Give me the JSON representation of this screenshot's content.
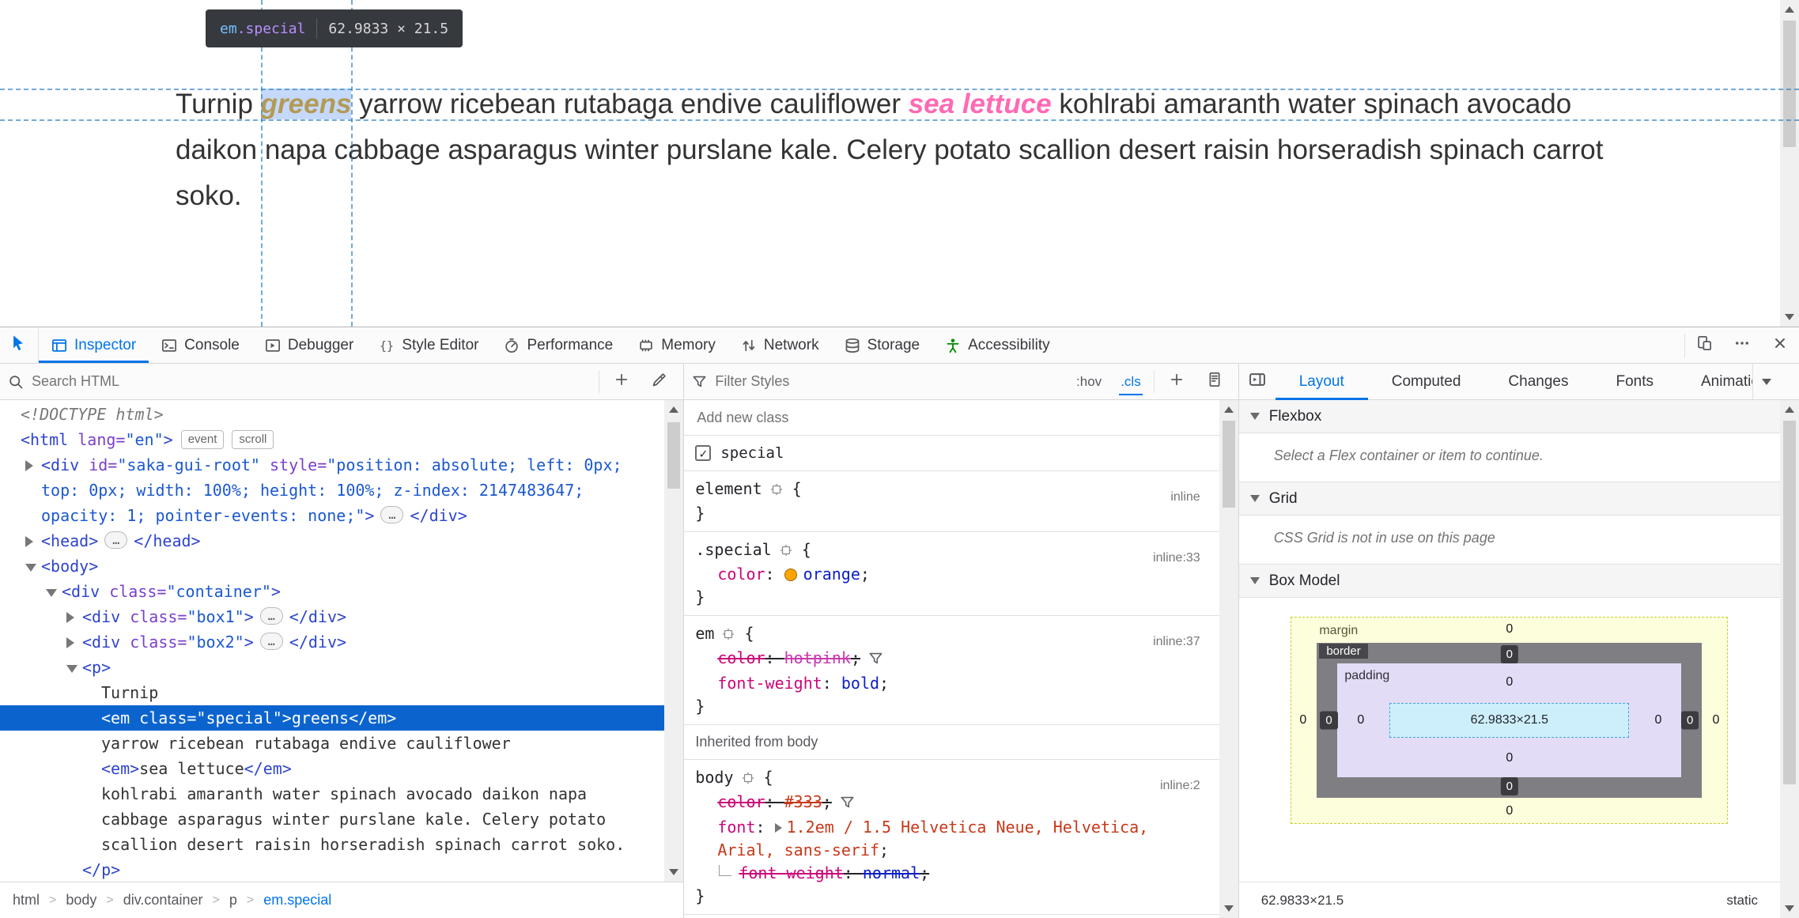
{
  "page": {
    "highlight_tooltip": {
      "tag": "em",
      "class": ".special",
      "dimensions": "62.9833 × 21.5"
    },
    "paragraph": {
      "t1": "Turnip ",
      "em_special": "greens",
      "t2": " yarrow ricebean rutabaga endive cauliflower ",
      "em": "sea lettuce",
      "t3": " kohlrabi amaranth water spinach avocado daikon napa cabbage asparagus winter purslane kale. Celery potato scallion desert raisin horseradish spinach carrot soko."
    },
    "colors": {
      "em_special_css": "orange",
      "em_css": "hotpink",
      "body_text": "#333",
      "highlight_fill": "#c4d9fb",
      "accent_blue": "#0074e8",
      "selection_blue": "#0b64ce"
    }
  },
  "toolbar": {
    "picker_icon": "picker-icon",
    "tabs": [
      {
        "label": "Inspector",
        "icon": "inspector-icon",
        "active": true
      },
      {
        "label": "Console",
        "icon": "console-icon"
      },
      {
        "label": "Debugger",
        "icon": "debugger-icon"
      },
      {
        "label": "Style Editor",
        "icon": "style-editor-icon"
      },
      {
        "label": "Performance",
        "icon": "performance-icon"
      },
      {
        "label": "Memory",
        "icon": "memory-icon"
      },
      {
        "label": "Network",
        "icon": "network-icon"
      },
      {
        "label": "Storage",
        "icon": "storage-icon"
      },
      {
        "label": "Accessibility",
        "icon": "accessibility-icon"
      }
    ],
    "right_buttons": [
      {
        "icon": "responsive-design-icon"
      },
      {
        "icon": "meatball-menu-icon"
      },
      {
        "icon": "close-icon"
      }
    ]
  },
  "markup_panel": {
    "search_placeholder": "Search HTML",
    "action_icons": [
      "add-node-icon",
      "eyedropper-icon"
    ],
    "lines": [
      {
        "indent": 0,
        "parts": [
          {
            "c": "doctype",
            "t": "<!DOCTYPE html>"
          }
        ]
      },
      {
        "indent": 0,
        "parts": [
          {
            "c": "tag",
            "t": "<html"
          },
          {
            "c": "attr",
            "t": " lang="
          },
          {
            "c": "val",
            "t": "\"en\""
          },
          {
            "c": "tag",
            "t": ">"
          },
          {
            "c": "badge",
            "t": "event"
          },
          {
            "c": "badge",
            "t": "scroll"
          }
        ]
      },
      {
        "indent": 1,
        "tw": "closed",
        "parts": [
          {
            "c": "tag",
            "t": "<div"
          },
          {
            "c": "attr",
            "t": " id="
          },
          {
            "c": "val",
            "t": "\"saka-gui-root\""
          },
          {
            "c": "attr",
            "t": " style="
          },
          {
            "c": "val",
            "t": "\"position: absolute; left: 0px; top: 0px; width: 100%; height: 100%; z-index: 2147483647; opacity: 1; pointer-events: none;\""
          },
          {
            "c": "tag",
            "t": ">"
          },
          {
            "c": "ellipsis",
            "t": "…"
          },
          {
            "c": "tag",
            "t": "</div>"
          }
        ]
      },
      {
        "indent": 1,
        "tw": "closed",
        "parts": [
          {
            "c": "tag",
            "t": "<head>"
          },
          {
            "c": "ellipsis",
            "t": "…"
          },
          {
            "c": "tag",
            "t": "</head>"
          }
        ]
      },
      {
        "indent": 1,
        "tw": "open",
        "parts": [
          {
            "c": "tag",
            "t": "<body>"
          }
        ]
      },
      {
        "indent": 2,
        "tw": "open",
        "parts": [
          {
            "c": "tag",
            "t": "<div"
          },
          {
            "c": "attr",
            "t": " class="
          },
          {
            "c": "val",
            "t": "\"container\""
          },
          {
            "c": "tag",
            "t": ">"
          }
        ]
      },
      {
        "indent": 3,
        "tw": "closed",
        "parts": [
          {
            "c": "tag",
            "t": "<div"
          },
          {
            "c": "attr",
            "t": " class="
          },
          {
            "c": "val",
            "t": "\"box1\""
          },
          {
            "c": "tag",
            "t": ">"
          },
          {
            "c": "ellipsis",
            "t": "…"
          },
          {
            "c": "tag",
            "t": "</div>"
          }
        ]
      },
      {
        "indent": 3,
        "tw": "closed",
        "parts": [
          {
            "c": "tag",
            "t": "<div"
          },
          {
            "c": "attr",
            "t": " class="
          },
          {
            "c": "val",
            "t": "\"box2\""
          },
          {
            "c": "tag",
            "t": ">"
          },
          {
            "c": "ellipsis",
            "t": "…"
          },
          {
            "c": "tag",
            "t": "</div>"
          }
        ]
      },
      {
        "indent": 3,
        "tw": "open",
        "parts": [
          {
            "c": "tag",
            "t": "<p>"
          }
        ]
      },
      {
        "indent": 4,
        "parts": [
          {
            "c": "text",
            "t": "Turnip"
          }
        ]
      },
      {
        "indent": 4,
        "sel": true,
        "parts": [
          {
            "c": "tag",
            "t": "<em"
          },
          {
            "c": "attr",
            "t": " class="
          },
          {
            "c": "val",
            "t": "\"special\""
          },
          {
            "c": "tag",
            "t": ">"
          },
          {
            "c": "text",
            "t": "greens"
          },
          {
            "c": "tag",
            "t": "</em>"
          }
        ]
      },
      {
        "indent": 4,
        "parts": [
          {
            "c": "text",
            "t": "yarrow ricebean rutabaga endive cauliflower"
          }
        ]
      },
      {
        "indent": 4,
        "parts": [
          {
            "c": "tag",
            "t": "<em>"
          },
          {
            "c": "text",
            "t": "sea lettuce"
          },
          {
            "c": "tag",
            "t": "</em>"
          }
        ]
      },
      {
        "indent": 4,
        "parts": [
          {
            "c": "text",
            "t": "kohlrabi amaranth water spinach avocado daikon napa cabbage asparagus winter purslane kale. Celery potato scallion desert raisin horseradish spinach carrot soko."
          }
        ]
      },
      {
        "indent": 3,
        "parts": [
          {
            "c": "tag",
            "t": "</p>"
          }
        ]
      }
    ],
    "breadcrumb": [
      {
        "t": "html"
      },
      {
        "t": "body"
      },
      {
        "t": "div.container"
      },
      {
        "t": "p"
      },
      {
        "t": "em.special",
        "active": true
      }
    ]
  },
  "rules_panel": {
    "filter_placeholder": "Filter Styles",
    "pseudo_toggle": ":hov",
    "class_toggle": ".cls",
    "add_class_placeholder": "Add new class",
    "class_checkbox": {
      "label": "special",
      "checked": true
    },
    "items": [
      {
        "type": "rule",
        "selector": "element",
        "link": "inline",
        "decls": []
      },
      {
        "type": "rule",
        "selector": ".special",
        "link": "inline:33",
        "decls": [
          {
            "prop": "color",
            "value": "orange",
            "swatch": "#ffa500"
          }
        ]
      },
      {
        "type": "rule",
        "selector": "em",
        "link": "inline:37",
        "decls": [
          {
            "prop": "color",
            "value": "hotpink",
            "struck": true,
            "filtericon": true,
            "vclass": "pink"
          },
          {
            "prop": "font-weight",
            "value": "bold"
          }
        ]
      },
      {
        "type": "inherited",
        "label": "Inherited from body"
      },
      {
        "type": "rule",
        "selector": "body",
        "link": "inline:2",
        "decls": [
          {
            "prop": "color",
            "value": "#333",
            "struck": true,
            "filtericon": true,
            "vclass": "red"
          },
          {
            "prop": "font",
            "value": "1.2em / 1.5 Helvetica Neue, Helvetica, Arial, sans-serif",
            "arrow": true,
            "vclass": "red"
          },
          {
            "prop": "font-weight",
            "value": "normal",
            "struck": true,
            "sub": true
          }
        ]
      }
    ]
  },
  "layout_panel": {
    "tabs": [
      {
        "label": "Layout",
        "active": true
      },
      {
        "label": "Computed"
      },
      {
        "label": "Changes"
      },
      {
        "label": "Fonts"
      },
      {
        "label": "Animations"
      }
    ],
    "flexbox": {
      "title": "Flexbox",
      "message": "Select a Flex container or item to continue."
    },
    "grid": {
      "title": "Grid",
      "message": "CSS Grid is not in use on this page"
    },
    "box_model": {
      "title": "Box Model",
      "margin_label": "margin",
      "border_label": "border",
      "padding_label": "padding",
      "values": {
        "margin_top": "0",
        "margin_right": "0",
        "margin_bottom": "0",
        "margin_left": "0",
        "border_top": "0",
        "border_right": "0",
        "border_bottom": "0",
        "border_left": "0",
        "padding_top": "0",
        "padding_right": "0",
        "padding_bottom": "0",
        "padding_left": "0"
      },
      "content_size": "62.9833×21.5",
      "element_size": "62.9833×21.5",
      "position": "static"
    }
  }
}
